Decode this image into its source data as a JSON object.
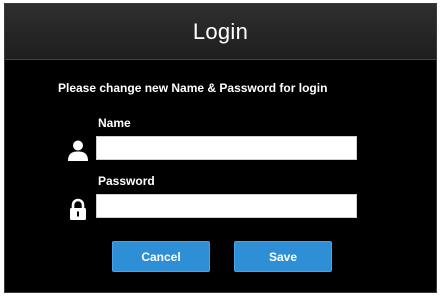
{
  "dialog": {
    "title": "Login",
    "instruction": "Please change new Name & Password for login"
  },
  "fields": {
    "name": {
      "label": "Name",
      "value": "",
      "placeholder": "",
      "icon": "user-icon"
    },
    "password": {
      "label": "Password",
      "value": "",
      "placeholder": "",
      "icon": "lock-icon"
    }
  },
  "buttons": {
    "cancel_label": "Cancel",
    "save_label": "Save"
  },
  "colors": {
    "background": "#000000",
    "titlebar": "#2a2a2a",
    "button": "#2f8fd6",
    "text": "#ffffff"
  }
}
